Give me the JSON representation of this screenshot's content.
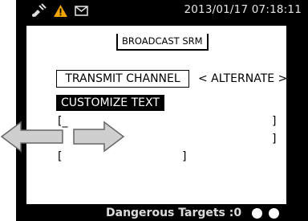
{
  "status_bar": {
    "icons": [
      "satellite-icon",
      "warning-icon",
      "envelope-icon"
    ],
    "datetime": "2013/01/17 07:18:11"
  },
  "screen_title": "BROADCAST SRM",
  "transmit_channel": {
    "label": "TRANSMIT CHANNEL",
    "value": "< ALTERNATE >"
  },
  "customize_text": {
    "label": "CUSTOMIZE TEXT",
    "lines": [
      {
        "open": "[_",
        "close": "]"
      },
      {
        "open": "",
        "close": "]"
      },
      {
        "open": "[",
        "close": "]"
      }
    ]
  },
  "footer": {
    "dangerous_targets": "Dangerous Targets :0"
  },
  "colors": {
    "screen_bg": "#000000",
    "panel_bg": "#ffffff",
    "warning": "#f2a400",
    "arrow_fill": "#cfcfcf"
  }
}
